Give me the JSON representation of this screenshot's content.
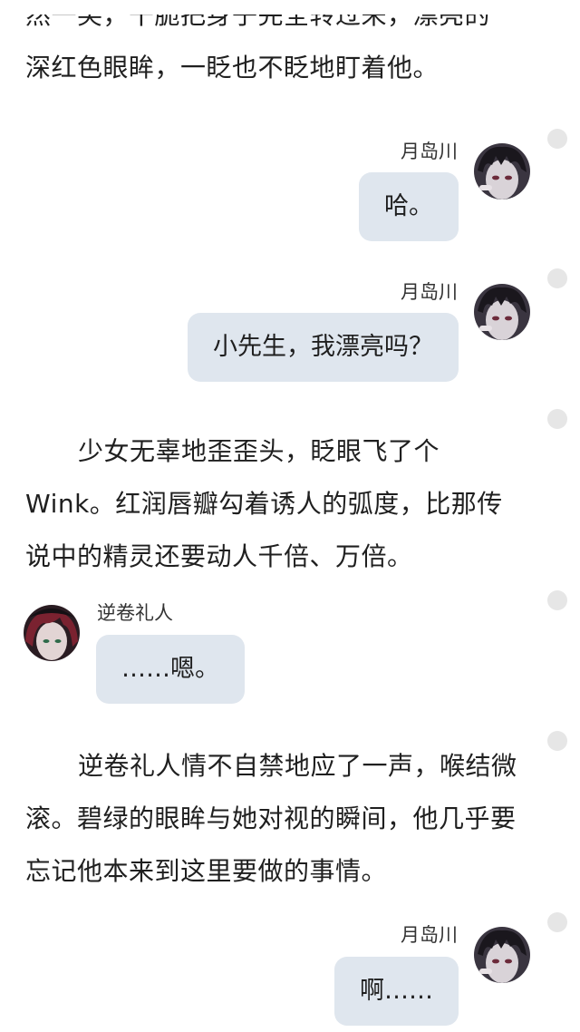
{
  "story": {
    "cut_paragraph_line1": "然一笑，干脆把身子完全转过来，漂亮的",
    "cut_paragraph_line2": "深红色眼眸，一眨也不眨地盯着他。",
    "paragraph1": "少女无辜地歪歪头，眨眼飞了个Wink。红润唇瓣勾着诱人的弧度，比那传说中的精灵还要动人千倍、万倍。",
    "paragraph2": "逆卷礼人情不自禁地应了一声，喉结微滚。碧绿的眼眸与她对视的瞬间，他几乎要忘记他本来到这里要做的事情。"
  },
  "messages": [
    {
      "speaker": "月岛川",
      "text": "哈。",
      "side": "right",
      "avatar": "dark-haired-boy-avatar"
    },
    {
      "speaker": "月岛川",
      "text": "小先生，我漂亮吗？",
      "side": "right",
      "avatar": "dark-haired-boy-avatar"
    },
    {
      "speaker": "逆卷礼人",
      "text": "……嗯。",
      "side": "left",
      "avatar": "red-haired-boy-avatar"
    },
    {
      "speaker": "月岛川",
      "text": "啊……",
      "side": "right",
      "avatar": "dark-haired-boy-avatar"
    }
  ],
  "colors": {
    "bubble": "#dfe6ee",
    "text": "#1f1f1f",
    "scroll_dot": "#e6e6e6"
  }
}
